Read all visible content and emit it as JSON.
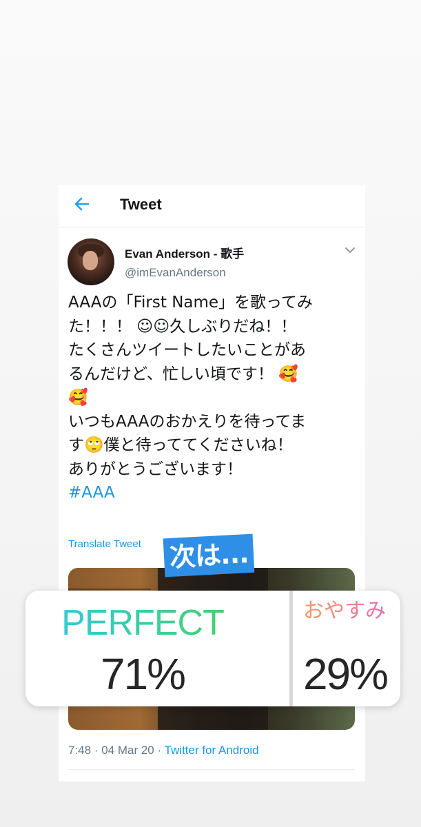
{
  "header": {
    "title": "Tweet",
    "back_icon": "back-arrow-icon"
  },
  "author": {
    "display_name": "Evan Anderson - 歌手",
    "handle": "@imEvanAnderson",
    "menu_icon": "chevron-down-icon"
  },
  "tweet": {
    "lines": [
      "AAAの「First Name」を歌ってみ",
      "た！！！ ☺☺久しぶりだね！！",
      "たくさんツイートしたいことがあ",
      "るんだけど、忙しい頃です！ 🥰",
      "🥰",
      "いつもAAAのおかえりを待ってま",
      "す🙄僕と待っててくださいね！",
      "ありがとうございます！"
    ],
    "hashtag": "#AAA",
    "translate_label": "Translate Tweet",
    "time": "7:48",
    "date": "04 Mar 20",
    "source": "Twitter for Android"
  },
  "sticker": {
    "text": "次は..."
  },
  "poll": {
    "options": [
      {
        "label": "PERFECT",
        "percent_text": "71%",
        "percent": 71
      },
      {
        "label": "おやすみ",
        "percent_text": "29%",
        "percent": 29
      }
    ],
    "colors": {
      "option_a_gradient": [
        "#2ec8ef",
        "#4ad25a"
      ],
      "option_b_gradient": [
        "#f59a58",
        "#e56bb6"
      ]
    }
  }
}
